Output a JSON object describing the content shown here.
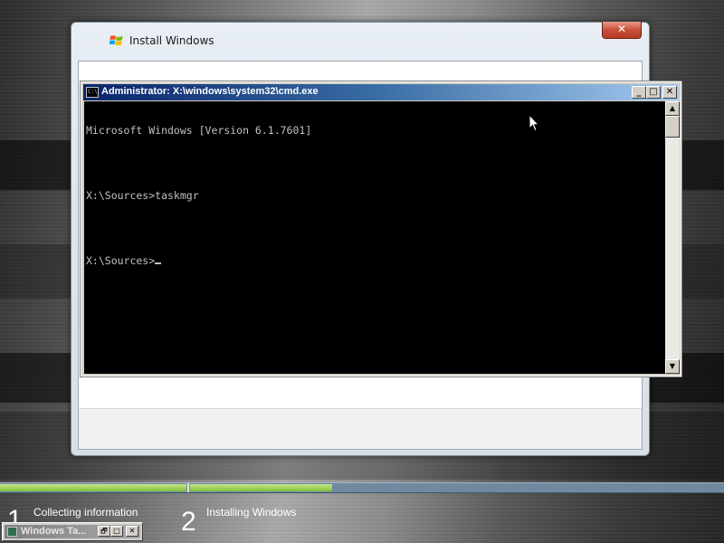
{
  "setup": {
    "title": "Install Windows",
    "close_glyph": "✕"
  },
  "cmd": {
    "title": "Administrator: X:\\windows\\system32\\cmd.exe",
    "icon_text": "C:\\",
    "buttons": {
      "minimize": "_",
      "maximize": "□",
      "close": "✕"
    },
    "lines": [
      "Microsoft Windows [Version 6.1.7601]",
      "",
      "X:\\Sources>taskmgr",
      "",
      "X:\\Sources>"
    ],
    "scroll_up": "▲",
    "scroll_down": "▼"
  },
  "progress": {
    "steps": [
      {
        "number": "1",
        "label": "Collecting information"
      },
      {
        "number": "2",
        "label": "Installing Windows"
      }
    ]
  },
  "taskmgr": {
    "title": "Windows Ta...",
    "buttons": {
      "restore": "🗗",
      "maximize": "□",
      "close": "✕"
    }
  },
  "colors": {
    "progress_fill": "#8fcf4a",
    "progress_track": "#6f8aa0",
    "cmd_title_start": "#0a246a"
  },
  "icons": [
    "windows-logo-icon",
    "cmd-icon",
    "mouse-pointer-icon",
    "taskmgr-icon"
  ]
}
